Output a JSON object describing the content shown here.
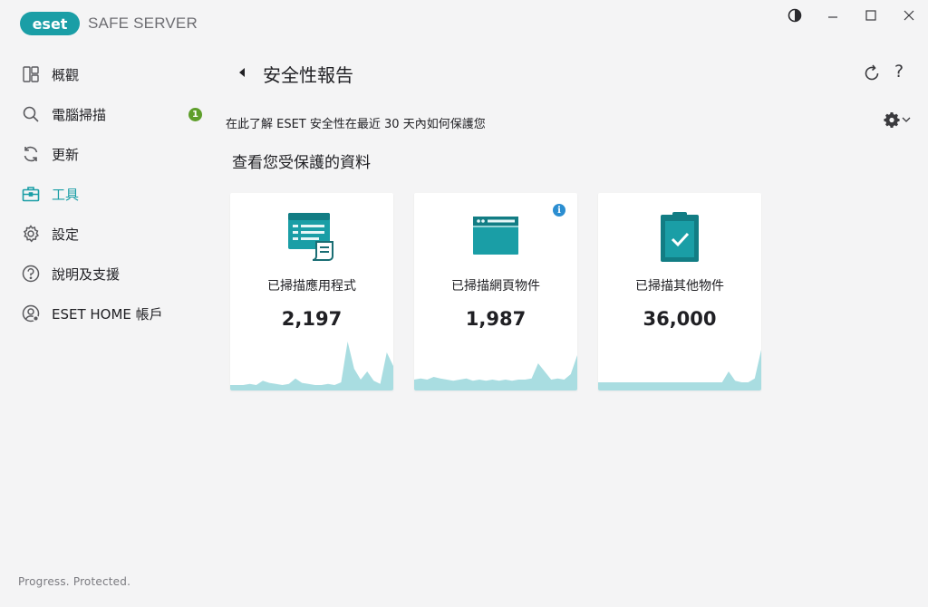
{
  "app": {
    "logo_text": "eset",
    "product_name": "SAFE SERVER",
    "brand_color": "#1a9ea6",
    "footer": "Progress. Protected."
  },
  "window_controls": [
    {
      "name": "theme-toggle-icon"
    },
    {
      "name": "minimize-icon"
    },
    {
      "name": "maximize-icon"
    },
    {
      "name": "close-icon"
    }
  ],
  "sidebar": {
    "items": [
      {
        "label": "概觀",
        "icon": "overview-icon",
        "active": false
      },
      {
        "label": "電腦掃描",
        "icon": "scan-icon",
        "active": false,
        "badge": "1"
      },
      {
        "label": "更新",
        "icon": "update-icon",
        "active": false
      },
      {
        "label": "工具",
        "icon": "tools-icon",
        "active": true
      },
      {
        "label": "設定",
        "icon": "settings-icon",
        "active": false
      },
      {
        "label": "說明及支援",
        "icon": "help-icon",
        "active": false
      },
      {
        "label": "ESET HOME 帳戶",
        "icon": "account-icon",
        "active": false
      }
    ]
  },
  "header": {
    "title": "安全性報告",
    "help_label": "?"
  },
  "main": {
    "subtitle": "在此了解 ESET 安全性在最近 30 天內如何保護您",
    "section_title": "查看您受保護的資料",
    "cards": [
      {
        "label": "已掃描應用程式",
        "value": "2,197",
        "icon": "applications-icon",
        "has_info": false,
        "trend": [
          0.1,
          0.1,
          0.1,
          0.12,
          0.1,
          0.18,
          0.14,
          0.12,
          0.1,
          0.12,
          0.22,
          0.14,
          0.12,
          0.1,
          0.1,
          0.12,
          0.1,
          0.15,
          0.9,
          0.4,
          0.2,
          0.35,
          0.18,
          0.12,
          0.7,
          0.45
        ]
      },
      {
        "label": "已掃描網頁物件",
        "value": "1,987",
        "icon": "web-objects-icon",
        "has_info": true,
        "info_label": "i",
        "trend": [
          0.2,
          0.22,
          0.2,
          0.25,
          0.22,
          0.2,
          0.18,
          0.2,
          0.22,
          0.18,
          0.2,
          0.18,
          0.2,
          0.18,
          0.2,
          0.18,
          0.2,
          0.2,
          0.22,
          0.5,
          0.35,
          0.2,
          0.22,
          0.2,
          0.3,
          0.65
        ]
      },
      {
        "label": "已掃描其他物件",
        "value": "36,000",
        "icon": "other-objects-icon",
        "has_info": false,
        "trend": [
          0.15,
          0.15,
          0.15,
          0.15,
          0.15,
          0.15,
          0.15,
          0.15,
          0.15,
          0.15,
          0.15,
          0.15,
          0.15,
          0.15,
          0.15,
          0.15,
          0.15,
          0.15,
          0.15,
          0.15,
          0.35,
          0.18,
          0.15,
          0.15,
          0.22,
          0.75
        ]
      }
    ]
  }
}
